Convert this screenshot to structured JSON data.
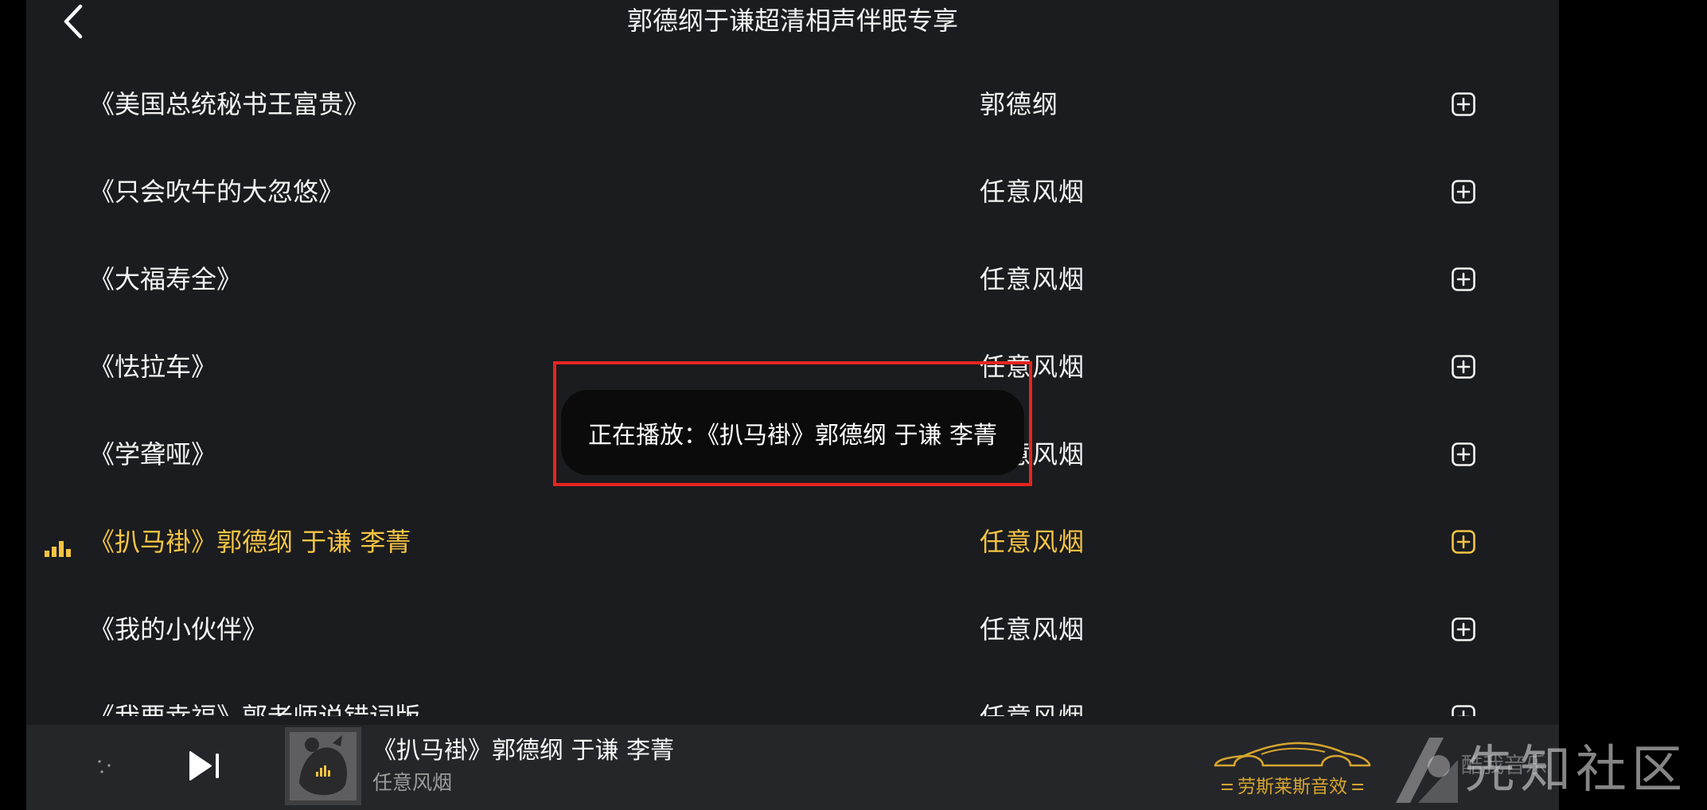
{
  "header": {
    "title": "郭德纲于谦超清相声伴眠专享",
    "back_icon": "chevron-left-icon"
  },
  "tracks": [
    {
      "title": "《美国总统秘书王富贵》",
      "artist": "郭德纲",
      "playing": false
    },
    {
      "title": "《只会吹牛的大忽悠》",
      "artist": "任意风烟",
      "playing": false
    },
    {
      "title": "《大福寿全》",
      "artist": "任意风烟",
      "playing": false
    },
    {
      "title": "《怯拉车》",
      "artist": "任意风烟",
      "playing": false
    },
    {
      "title": "《学聋哑》",
      "artist": "任意风烟",
      "playing": false
    },
    {
      "title": "《扒马褂》郭德纲 于谦 李菁",
      "artist": "任意风烟",
      "playing": true
    },
    {
      "title": "《我的小伙伴》",
      "artist": "任意风烟",
      "playing": false
    },
    {
      "title": "《我要幸福》郭老师说错词版",
      "artist": "任意风烟",
      "playing": false
    }
  ],
  "track_icons": {
    "add": "add-square-icon",
    "now_playing": "equalizer-bars-icon"
  },
  "toast": {
    "text": "正在播放：《扒马褂》郭德纲 于谦 李菁"
  },
  "mini_player": {
    "title": "《扒马褂》郭德纲 于谦 李菁",
    "artist": "任意风烟",
    "icons": {
      "loading": "loading-dots-icon",
      "next": "next-track-icon",
      "cover": "album-art-icon"
    }
  },
  "sound_effect": {
    "label": "劳斯莱斯音效",
    "icon": "car-icon"
  },
  "watermark": {
    "text": "先知社区",
    "app_name": "酷我音乐"
  },
  "colors": {
    "accent": "#f5c443",
    "annotation": "#e5251f",
    "sound_effect_gold": "#d6a52e",
    "panel_bg": "#1b1c1f",
    "mini_player_bg": "#25262a"
  }
}
